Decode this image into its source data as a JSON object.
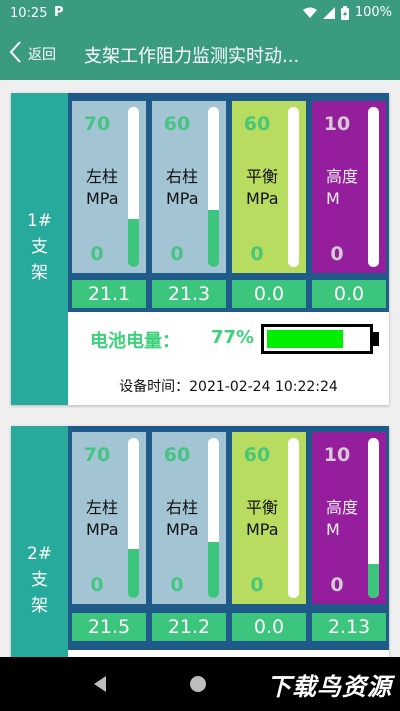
{
  "status": {
    "time": "10:25",
    "battery_text": "100%"
  },
  "header": {
    "back_label": "返回",
    "title": "支架工作阻力监测实时动..."
  },
  "cards": [
    {
      "side": [
        "1#",
        "支",
        "架"
      ],
      "gauges": [
        {
          "max": "70",
          "min": "0",
          "label1": "左柱",
          "label2": "MPa",
          "value": "21.1",
          "level": 0.3
        },
        {
          "max": "60",
          "min": "0",
          "label1": "右柱",
          "label2": "MPa",
          "value": "21.3",
          "level": 0.355
        },
        {
          "max": "60",
          "min": "0",
          "label1": "平衡",
          "label2": "MPa",
          "value": "0.0",
          "level": 0
        },
        {
          "max": "10",
          "min": "0",
          "label1": "高度",
          "label2": "M",
          "value": "0.0",
          "level": 0
        }
      ],
      "battery_label": "电池电量：",
      "battery_pct": "77%",
      "battery_level": 0.77,
      "device_time": "设备时间：2021-02-24 10:22:24"
    },
    {
      "side": [
        "2#",
        "支",
        "架"
      ],
      "gauges": [
        {
          "max": "70",
          "min": "0",
          "label1": "左柱",
          "label2": "MPa",
          "value": "21.5",
          "level": 0.307
        },
        {
          "max": "60",
          "min": "0",
          "label1": "右柱",
          "label2": "MPa",
          "value": "21.2",
          "level": 0.353
        },
        {
          "max": "60",
          "min": "0",
          "label1": "平衡",
          "label2": "MPa",
          "value": "0.0",
          "level": 0
        },
        {
          "max": "10",
          "min": "0",
          "label1": "高度",
          "label2": "M",
          "value": "2.13",
          "level": 0.213
        }
      ]
    }
  ],
  "watermark": "下载鸟资源",
  "colors": {
    "primary": "#3a9b80",
    "side": "#27a99c",
    "panel": "#1f5a88",
    "fill": "#3cc57c",
    "battery": "#00ee00"
  }
}
